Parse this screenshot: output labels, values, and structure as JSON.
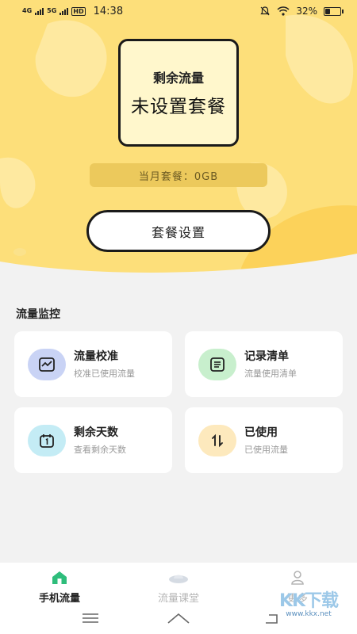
{
  "status_bar": {
    "signal1": "4G",
    "signal2": "5G",
    "hd": "HD",
    "time": "14:38",
    "battery": "32%",
    "battery_level": 0.32
  },
  "hero": {
    "remaining_label": "剩余流量",
    "remaining_value": "未设置套餐",
    "month_plan": "当月套餐：0GB",
    "set_button": "套餐设置"
  },
  "monitor": {
    "title": "流量监控",
    "tiles": [
      {
        "title": "流量校准",
        "subtitle": "校准已使用流量",
        "icon": "chart-icon",
        "color": "#c9d3f5",
        "fg": "#3b4a8c"
      },
      {
        "title": "记录清单",
        "subtitle": "流量使用清单",
        "icon": "list-icon",
        "color": "#c8efcd",
        "fg": "#2e6b38"
      },
      {
        "title": "剩余天数",
        "subtitle": "查看剩余天数",
        "icon": "calendar-icon",
        "color": "#c4ecf5",
        "fg": "#1f5d6e"
      },
      {
        "title": "已使用",
        "subtitle": "已使用流量",
        "icon": "sort-icon",
        "color": "#fde9bd",
        "fg": "#6b4f17"
      }
    ]
  },
  "tabbar": {
    "tabs": [
      {
        "label": "手机流量",
        "icon": "home-icon"
      },
      {
        "label": "流量课堂",
        "icon": "ufo-icon"
      },
      {
        "label": "更多",
        "icon": "user-icon"
      }
    ]
  },
  "watermark": {
    "logo": "KK下载",
    "url": "www.kkx.net"
  },
  "colors": {
    "hero_bg": "#fddf7a",
    "accent": "#2ebd7b"
  }
}
